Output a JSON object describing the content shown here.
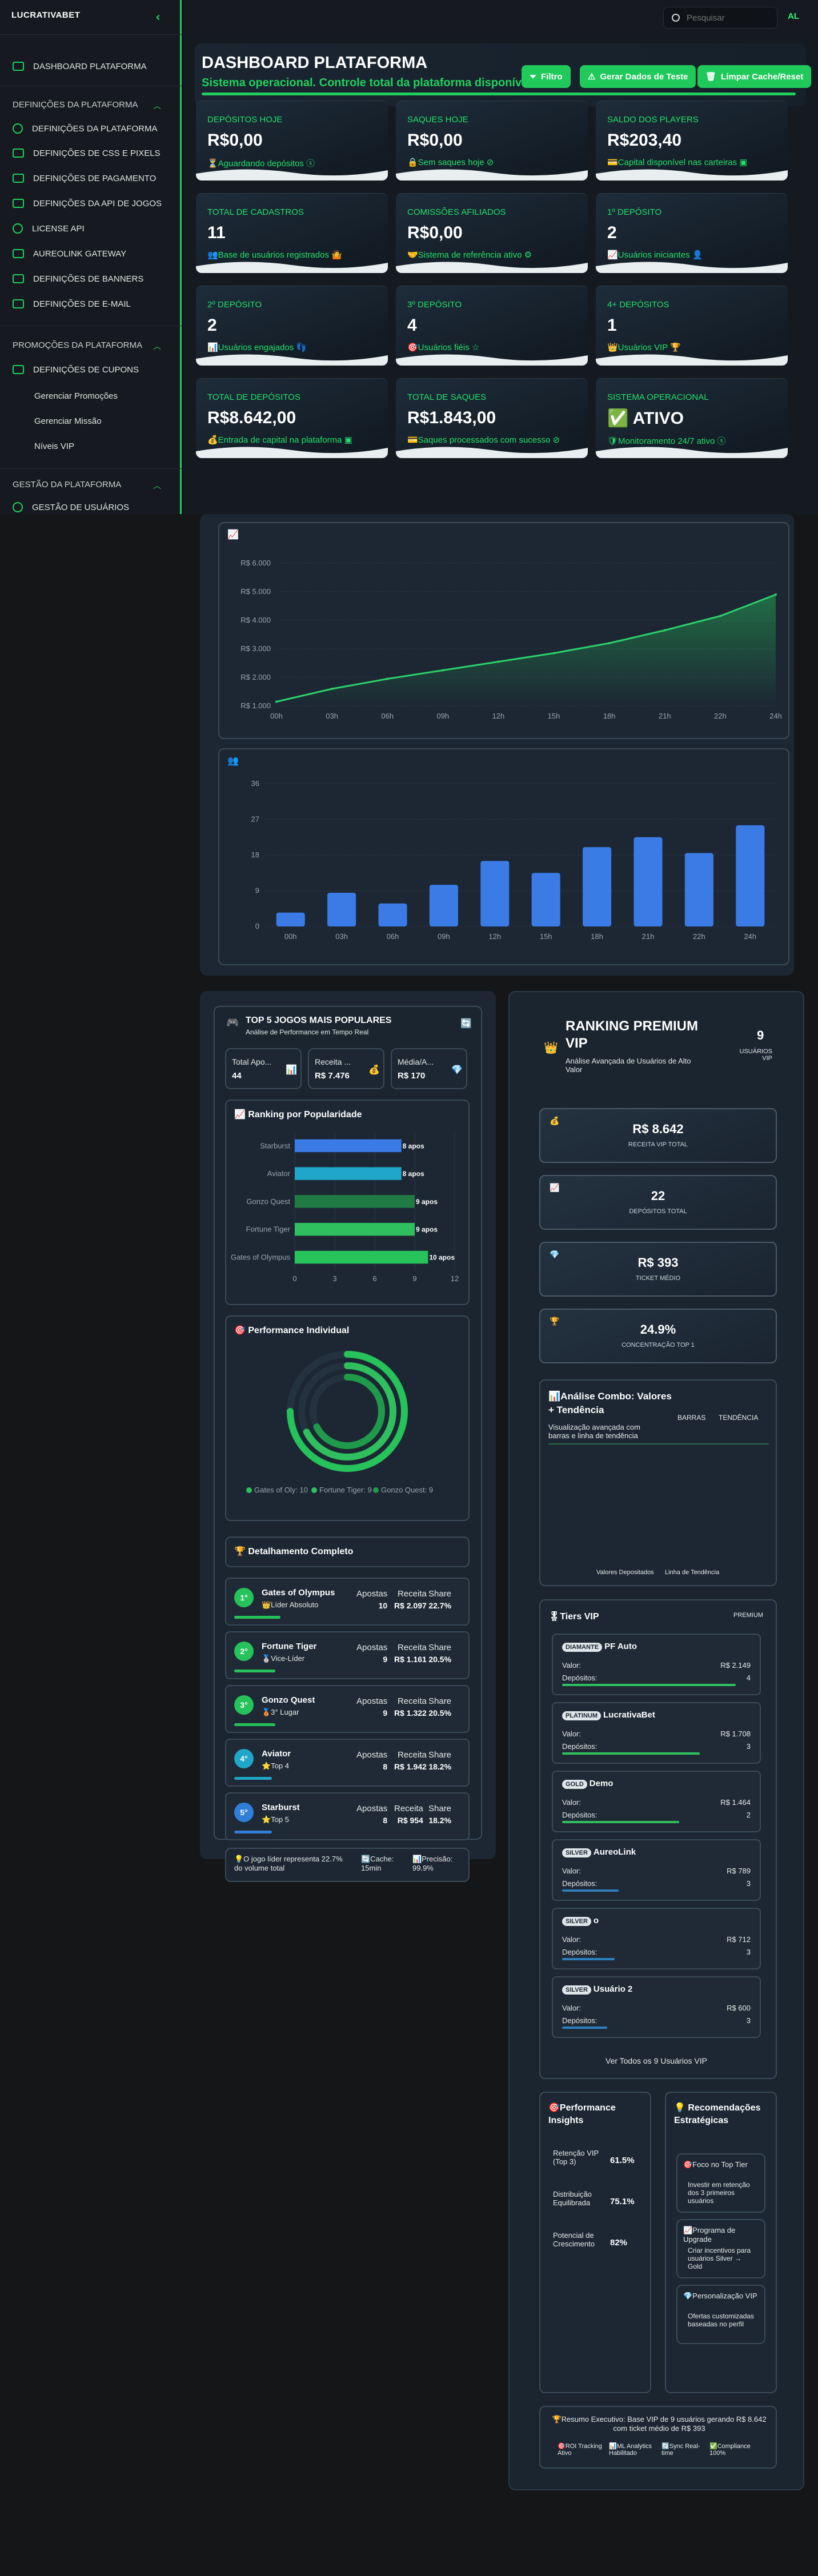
{
  "app": {
    "logo": "LUCRATIVABET",
    "logo_accent": "BET",
    "collapse_icon": "‹",
    "search_placeholder": "Pesquisar",
    "avatar": "AL"
  },
  "sidebar": {
    "items": [
      {
        "label": "DASHBOARD PLATAFORMA",
        "icon": "home-icon"
      },
      {
        "section": "DEFINIÇÕES DA PLATAFORMA"
      },
      {
        "label": "DEFINIÇÕES DA PLATAFORMA",
        "icon": "settings-icon"
      },
      {
        "label": "DEFINIÇÕES DE CSS E PIXELS",
        "icon": "code-icon"
      },
      {
        "label": "DEFINIÇÕES DE PAGAMENTO",
        "icon": "card-icon"
      },
      {
        "label": "DEFINIÇÕES DA API DE JOGOS",
        "icon": "controller-icon"
      },
      {
        "label": "LICENSE API",
        "icon": "key-icon"
      },
      {
        "label": "AUREOLINK GATEWAY",
        "icon": "gateway-icon"
      },
      {
        "label": "DEFINIÇÕES DE BANNERS",
        "icon": "banner-icon"
      },
      {
        "label": "DEFINIÇÕES DE E-MAIL",
        "icon": "mail-icon"
      },
      {
        "section": "PROMOÇÕES DA PLATAFORMA"
      },
      {
        "label": "DEFINIÇÕES DE CUPONS",
        "icon": "ticket-icon"
      },
      {
        "label": "Gerenciar Promoções",
        "icon": ""
      },
      {
        "label": "Gerenciar Missão",
        "icon": ""
      },
      {
        "label": "Níveis VIP",
        "icon": ""
      },
      {
        "section": "GESTÃO DA PLATAFORMA"
      },
      {
        "label": "GESTÃO DE USUÁRIOS",
        "icon": "users-icon"
      }
    ]
  },
  "header": {
    "title": "DASHBOARD PLATAFORMA",
    "subtitle": "Sistema operacional. Controle total da plataforma disponível.",
    "btn_filter": "Filtro",
    "btn_test": "Gerar Dados de Teste",
    "btn_clear": "Limpar Cache/Reset"
  },
  "cards": [
    {
      "label": "DEPÓSITOS HOJE",
      "value": "R$0,00",
      "sub": "⏳Aguardando depósitos ⓢ"
    },
    {
      "label": "SAQUES HOJE",
      "value": "R$0,00",
      "sub": "🔒Sem saques hoje ⊘"
    },
    {
      "label": "SALDO DOS PLAYERS",
      "value": "R$203,40",
      "sub": "💳Capital disponível nas carteiras ▣"
    },
    {
      "label": "TOTAL DE CADASTROS",
      "value": "11",
      "sub": "👥Base de usuários registrados 🤷"
    },
    {
      "label": "COMISSÕES AFILIADOS",
      "value": "R$0,00",
      "sub": "🤝Sistema de referência ativo ⚙"
    },
    {
      "label": "1º DEPÓSITO",
      "value": "2",
      "sub": "📈Usuários iniciantes 👤"
    },
    {
      "label": "2º DEPÓSITO",
      "value": "2",
      "sub": "📊Usuários engajados 👣"
    },
    {
      "label": "3º DEPÓSITO",
      "value": "4",
      "sub": "🎯Usuários fiéis ☆"
    },
    {
      "label": "4+ DEPÓSITOS",
      "value": "1",
      "sub": "👑Usuários VIP 🏆"
    },
    {
      "label": "TOTAL DE DEPÓSITOS",
      "value": "R$8.642,00",
      "sub": "💰Entrada de capital na plataforma ▣"
    },
    {
      "label": "TOTAL DE SAQUES",
      "value": "R$1.843,00",
      "sub": "💳Saques processados com sucesso ⊘"
    },
    {
      "label": "SISTEMA OPERACIONAL",
      "value": "✅ ATIVO",
      "sub": "🛡Monitoramento 24/7 ativo ⓢ"
    }
  ],
  "line_chart": {
    "icon": "📈",
    "yticks": [
      "R$ 1.000",
      "R$ 2.000",
      "R$ 3.000",
      "R$ 4.000",
      "R$ 5.000",
      "R$ 6.000"
    ],
    "xticks": [
      "00h",
      "03h",
      "06h",
      "09h",
      "12h",
      "15h",
      "18h",
      "21h",
      "22h",
      "24h"
    ]
  },
  "bar_chart": {
    "icon": "👥",
    "yticks": [
      "0",
      "9",
      "18",
      "27",
      "36"
    ],
    "xticks": [
      "00h",
      "03h",
      "06h",
      "09h",
      "12h",
      "15h",
      "18h",
      "21h",
      "22h",
      "24h"
    ]
  },
  "chart_data": [
    {
      "type": "area",
      "x": [
        "00h",
        "03h",
        "06h",
        "09h",
        "12h",
        "15h",
        "18h",
        "21h",
        "22h",
        "24h"
      ],
      "values": [
        1150,
        1600,
        1950,
        2250,
        2550,
        2850,
        3200,
        3650,
        4150,
        4900
      ],
      "ylim": [
        1000,
        6000
      ],
      "grid": true,
      "title": "",
      "xlabel": "",
      "ylabel": ""
    },
    {
      "type": "bar",
      "categories": [
        "00h",
        "03h",
        "06h",
        "09h",
        "12h",
        "15h",
        "18h",
        "21h",
        "22h",
        "24h"
      ],
      "values": [
        3.5,
        8.5,
        5.8,
        10.5,
        16.5,
        13.5,
        20,
        22.5,
        18.5,
        25.5
      ],
      "ylim": [
        0,
        36
      ],
      "grid": true,
      "title": "",
      "xlabel": "",
      "ylabel": ""
    },
    {
      "type": "bar",
      "orientation": "horizontal",
      "categories": [
        "Starburst",
        "Aviator",
        "Gonzo Quest",
        "Fortune Tiger",
        "Gates of Olympus"
      ],
      "values": [
        8,
        8,
        9,
        9,
        10
      ],
      "data_labels": [
        "8 apos",
        "8 apos",
        "9 apos",
        "9 apos",
        "10 apos"
      ],
      "xticks": [
        "0",
        "3",
        "6",
        "9",
        "12"
      ],
      "xlim": [
        0,
        12
      ]
    },
    {
      "type": "radial-bar",
      "series": [
        {
          "name": "Gates of Oly: 10",
          "value": 10
        },
        {
          "name": "Fortune Tiger: 9",
          "value": 9
        },
        {
          "name": "Gonzo Quest: 9",
          "value": 9
        }
      ]
    }
  ],
  "games": {
    "title": "TOP 5 JOGOS MAIS POPULARES",
    "subtitle": "Análise de Performance em Tempo Real",
    "stats": [
      {
        "label": "Total Apo...",
        "value": "44",
        "icon": "📊"
      },
      {
        "label": "Receita ...",
        "value": "R$ 7.476",
        "icon": "💰"
      },
      {
        "label": "Média/A...",
        "value": "R$ 170",
        "icon": "💎"
      }
    ],
    "ranking_title": "📈 Ranking por Popularidade",
    "perf_title": "🎯 Performance Individual",
    "detail_title": "🏆 Detalhamento Completo",
    "col_labels": [
      "Apostas",
      "Receita",
      "Share"
    ],
    "details": [
      {
        "rank": "1°",
        "name": "Gates of Olympus",
        "tag": "👑Líder Absoluto",
        "bets": "10",
        "revenue": "R$ 2.097",
        "share": "22.7%"
      },
      {
        "rank": "2°",
        "name": "Fortune Tiger",
        "tag": "🥈Vice-Líder",
        "bets": "9",
        "revenue": "R$ 1.161",
        "share": "20.5%"
      },
      {
        "rank": "3°",
        "name": "Gonzo Quest",
        "tag": "🥉3° Lugar",
        "bets": "9",
        "revenue": "R$ 1.322",
        "share": "20.5%"
      },
      {
        "rank": "4°",
        "name": "Aviator",
        "tag": "⭐Top 4",
        "bets": "8",
        "revenue": "R$ 1.942",
        "share": "18.2%"
      },
      {
        "rank": "5°",
        "name": "Starburst",
        "tag": "⭐Top 5",
        "bets": "8",
        "revenue": "R$ 954",
        "share": "18.2%"
      }
    ],
    "footer_a": "💡O jogo líder representa 22.7% do volume total",
    "footer_b": "🔄Cache: 15min",
    "footer_c": "📊Precisão: 99.9%"
  },
  "ranking": {
    "title": "RANKING PREMIUM VIP",
    "subtitle": "Análise Avançada de Usuários de Alto Valor",
    "count": "9",
    "count_label": "USUÁRIOS VIP",
    "kpis": [
      {
        "icon": "💰",
        "value": "R$ 8.642",
        "label": "RECEITA VIP TOTAL"
      },
      {
        "icon": "📈",
        "value": "22",
        "label": "DEPÓSITOS TOTAL"
      },
      {
        "icon": "💎",
        "value": "R$ 393",
        "label": "TICKET MÉDIO"
      },
      {
        "icon": "🏆",
        "value": "24.9%",
        "label": "CONCENTRAÇÃO TOP 1"
      }
    ],
    "combo_title": "📊Análise Combo: Valores + Tendência",
    "combo_sub": "Visualização avançada com barras e linha de tendência",
    "combo_tabs": [
      "BARRAS",
      "TENDÊNCIA"
    ],
    "combo_legend": [
      "Valores Depositados",
      "Linha de Tendência"
    ],
    "tiers_title": "🎖Tiers VIP",
    "tiers_badge": "PREMIUM",
    "tiers": [
      {
        "badge": "DIAMANTE",
        "name": "PF Auto",
        "valor": "R$ 2.149",
        "depositos": "4",
        "color": "#2fbf5e",
        "fill": 0.92
      },
      {
        "badge": "PLATINUM",
        "name": "LucrativaBet",
        "valor": "R$ 1.708",
        "depositos": "3",
        "color": "#2fbf5e",
        "fill": 0.73
      },
      {
        "badge": "GOLD",
        "name": "Demo",
        "valor": "R$ 1.464",
        "depositos": "2",
        "color": "#2fbf5e",
        "fill": 0.62
      },
      {
        "badge": "SILVER",
        "name": "AureoLink",
        "valor": "R$ 789",
        "depositos": "3",
        "color": "#2f7fbf",
        "fill": 0.3
      },
      {
        "badge": "SILVER",
        "name": "o",
        "valor": "R$ 712",
        "depositos": "3",
        "color": "#2f7fbf",
        "fill": 0.28
      },
      {
        "badge": "SILVER",
        "name": "Usuário 2",
        "valor": "R$ 600",
        "depositos": "3",
        "color": "#2f7fbf",
        "fill": 0.24
      }
    ],
    "valor_label": "Valor:",
    "dep_label": "Depósitos:",
    "view_all": "Ver Todos os 9 Usuários VIP",
    "insights_title": "🎯Performance Insights",
    "insights": [
      {
        "label": "Retenção VIP (Top 3)",
        "value": "61.5%"
      },
      {
        "label": "Distribuição Equilibrada",
        "value": "75.1%"
      },
      {
        "label": "Potencial de Crescimento",
        "value": "82%"
      }
    ],
    "reco_title": "💡 Recomendações Estratégicas",
    "recos": [
      {
        "title": "🎯Foco no Top Tier",
        "text": "Investir em retenção dos 3 primeiros usuários"
      },
      {
        "title": "📈Programa de Upgrade",
        "text": "Criar incentivos para usuários Silver → Gold"
      },
      {
        "title": "💎Personalização VIP",
        "text": "Ofertas customizadas baseadas no perfil"
      }
    ],
    "summary": "🏆Resumo Executivo: Base VIP de 9 usuários gerando R$ 8.642 com ticket médio de R$ 393",
    "badges": [
      "🎯ROI Tracking Ativo",
      "📊ML Analytics Habilitado",
      "🔄Sync Real-time",
      "✅Compliance 100%"
    ]
  }
}
